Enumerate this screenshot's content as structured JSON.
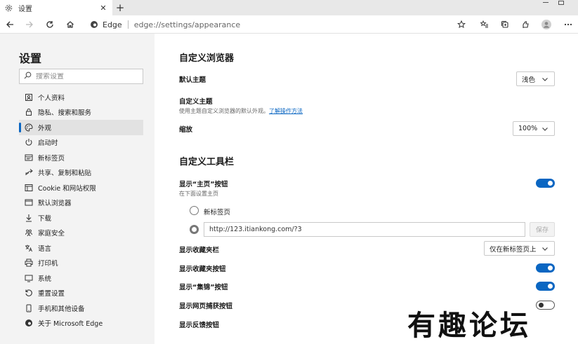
{
  "tab": {
    "title": "设置",
    "icon": "gear-icon"
  },
  "toolbar": {
    "site_name": "Edge",
    "url": "edge://settings/appearance"
  },
  "sidebar": {
    "title": "设置",
    "search_placeholder": "搜索设置",
    "items": [
      {
        "label": "个人资料",
        "icon": "profile-icon",
        "active": false
      },
      {
        "label": "隐私、搜索和服务",
        "icon": "lock-icon",
        "active": false
      },
      {
        "label": "外观",
        "icon": "palette-icon",
        "active": true
      },
      {
        "label": "启动时",
        "icon": "power-icon",
        "active": false
      },
      {
        "label": "新标签页",
        "icon": "newtab-icon",
        "active": false
      },
      {
        "label": "共享、复制和粘贴",
        "icon": "share-icon",
        "active": false
      },
      {
        "label": "Cookie 和网站权限",
        "icon": "cookie-icon",
        "active": false
      },
      {
        "label": "默认浏览器",
        "icon": "browser-icon",
        "active": false
      },
      {
        "label": "下载",
        "icon": "download-icon",
        "active": false
      },
      {
        "label": "家庭安全",
        "icon": "family-icon",
        "active": false
      },
      {
        "label": "语言",
        "icon": "language-icon",
        "active": false
      },
      {
        "label": "打印机",
        "icon": "printer-icon",
        "active": false
      },
      {
        "label": "系统",
        "icon": "system-icon",
        "active": false
      },
      {
        "label": "重置设置",
        "icon": "reset-icon",
        "active": false
      },
      {
        "label": "手机和其他设备",
        "icon": "phone-icon",
        "active": false
      },
      {
        "label": "关于 Microsoft Edge",
        "icon": "edge-logo-icon",
        "active": false
      }
    ]
  },
  "main": {
    "browser_section": {
      "title": "自定义浏览器",
      "default_theme_label": "默认主题",
      "default_theme_value": "浅色",
      "custom_theme_label": "自定义主题",
      "custom_theme_desc": "使用主题自定义浏览器的默认外观。",
      "custom_theme_link": "了解操作方法",
      "zoom_label": "缩放",
      "zoom_value": "100%"
    },
    "toolbar_section": {
      "title": "自定义工具栏",
      "home_button_label": "显示“主页”按钮",
      "home_button_desc": "在下面设置主页",
      "home_button_on": true,
      "radio_newtab_label": "新标签页",
      "home_url_value": "http://123.itiankong.com/?3",
      "save_label": "保存",
      "favorites_bar_label": "显示收藏夹栏",
      "favorites_bar_value": "仅在新标签页上",
      "favorites_button_label": "显示收藏夹按钮",
      "favorites_button_on": true,
      "collections_button_label": "显示“集锦”按钮",
      "collections_button_on": true,
      "web_capture_label": "显示网页捕获按钮",
      "web_capture_on": false,
      "feedback_label": "显示反馈按钮"
    }
  },
  "watermark": "有趣论坛",
  "colors": {
    "accent": "#0a66c2",
    "sidebar_bg": "#f3f3f3",
    "tabstrip_bg": "#e8e8e8"
  }
}
